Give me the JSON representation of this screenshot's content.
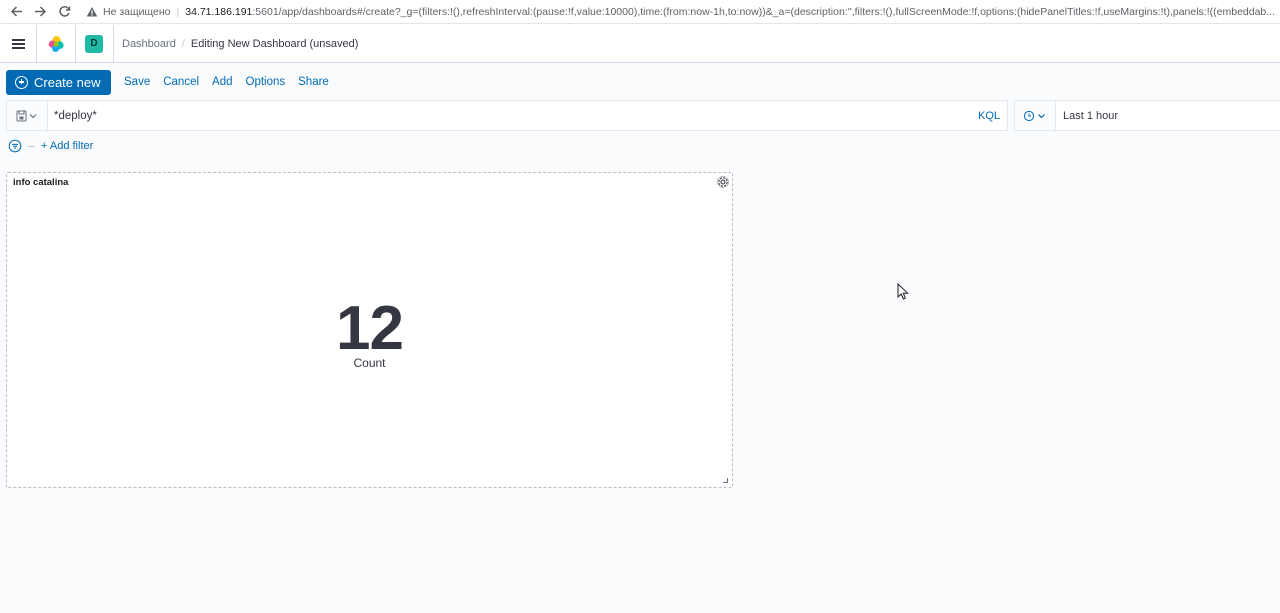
{
  "browser": {
    "insecure_label": "Не защищено",
    "url_host": "34.71.186.191",
    "url_rest": ":5601/app/dashboards#/create?_g=(filters:!(),refreshInterval:(pause:!f,value:10000),time:(from:now-1h,to:now))&_a=(description:'',filters:!(),fullScreenMode:!f,options:(hidePanelTitles:!f,useMargins:!t),panels:!((embeddab..."
  },
  "header": {
    "space_initial": "D",
    "breadcrumbs": [
      "Dashboard",
      "Editing New Dashboard (unsaved)"
    ]
  },
  "topnav": {
    "create_label": "Create new",
    "links": [
      "Save",
      "Cancel",
      "Add",
      "Options",
      "Share"
    ]
  },
  "query": {
    "value": "*deploy*",
    "language": "KQL"
  },
  "time": {
    "label": "Last 1 hour"
  },
  "filters": {
    "add_label": "+ Add filter"
  },
  "panel": {
    "title": "info catalina",
    "metric_value": "12",
    "metric_label": "Count"
  },
  "colors": {
    "primary": "#006bb4",
    "space_avatar": "#20b9a6",
    "text": "#343741"
  }
}
